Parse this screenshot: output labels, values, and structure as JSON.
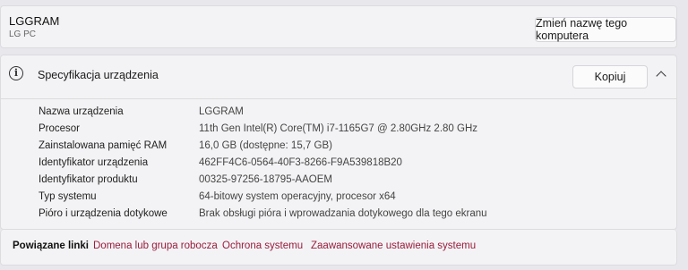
{
  "computer": {
    "name": "LGGRAM",
    "model": "LG PC",
    "rename_button": "Zmień nazwę tego komputera"
  },
  "specs": {
    "title": "Specyfikacja urządzenia",
    "copy_button": "Kopiuj",
    "rows": [
      {
        "label": "Nazwa urządzenia",
        "value": "LGGRAM"
      },
      {
        "label": "Procesor",
        "value": "11th Gen Intel(R) Core(TM) i7-1165G7 @ 2.80GHz   2.80 GHz"
      },
      {
        "label": "Zainstalowana pamięć RAM",
        "value": "16,0 GB (dostępne: 15,7 GB)"
      },
      {
        "label": "Identyfikator urządzenia",
        "value": "462FF4C6-0564-40F3-8266-F9A539818B20"
      },
      {
        "label": "Identyfikator produktu",
        "value": "00325-97256-18795-AAOEM"
      },
      {
        "label": "Typ systemu",
        "value": "64-bitowy system operacyjny, procesor x64"
      },
      {
        "label": "Pióro i urządzenia dotykowe",
        "value": "Brak obsługi pióra i wprowadzania dotykowego dla tego ekranu"
      }
    ]
  },
  "related": {
    "title": "Powiązane linki",
    "links": [
      "Domena lub grupa robocza",
      "Ochrona systemu",
      "Zaawansowane ustawienia systemu"
    ]
  },
  "colors": {
    "link": "#9a1c3c",
    "card_bg": "#f3f3f5",
    "page_bg": "#e8e8ec"
  }
}
